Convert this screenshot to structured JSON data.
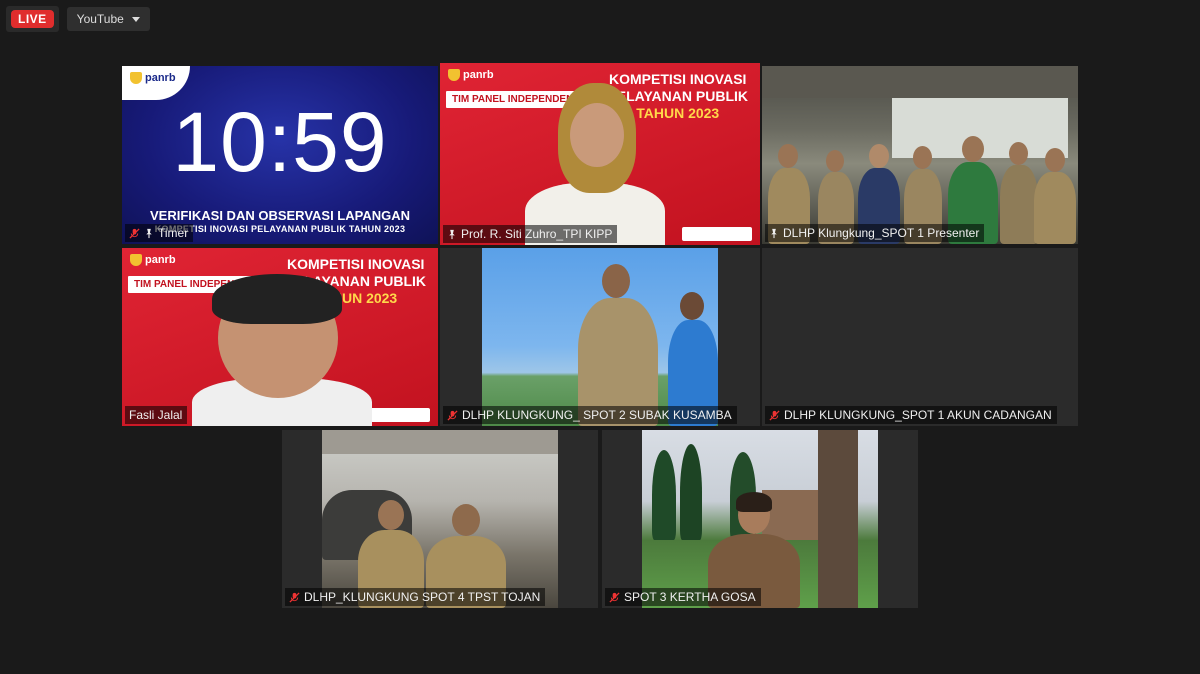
{
  "topbar": {
    "live": "LIVE",
    "platform": "YouTube"
  },
  "tiles": {
    "timer": {
      "name": "Timer",
      "logo": "panrb",
      "time": "10:59",
      "line1": "VERIFIKASI DAN OBSERVASI LAPANGAN",
      "line2": "KOMPETISI INOVASI PELAYANAN PUBLIK TAHUN 2023"
    },
    "zuhro": {
      "name": "Prof. R. Siti Zuhro_TPI KIPP",
      "logo": "panrb",
      "heading1": "KOMPETISI INOVASI",
      "heading2": "PELAYANAN PUBLIK",
      "heading3": "TAHUN 2023",
      "strip": "TIM PANEL INDEPENDEN"
    },
    "spot1presenter": {
      "name": "DLHP Klungkung_SPOT 1 Presenter"
    },
    "fasli": {
      "name": "Fasli Jalal",
      "logo": "panrb",
      "heading1": "KOMPETISI INOVASI",
      "heading2": "PELAYANAN PUBLIK",
      "heading3": "TAHUN 2023",
      "strip": "TIM PANEL INDEPENDEN"
    },
    "spot2": {
      "name": "DLHP KLUNGKUNG_ SPOT 2 SUBAK KUSAMBA"
    },
    "spot1backup": {
      "name": "DLHP KLUNGKUNG_SPOT 1 AKUN CADANGAN"
    },
    "spot4": {
      "name": "DLHP_KLUNGKUNG SPOT 4 TPST TOJAN"
    },
    "spot3": {
      "name": "SPOT 3 KERTHA GOSA"
    }
  },
  "icons": {
    "mute": "mic-off-icon",
    "pin": "pin-icon"
  },
  "colors": {
    "live": "#e02d2d",
    "active_speaker": "#d7e87a",
    "slide_red": "#c2121f",
    "timer_blue": "#171a78"
  }
}
